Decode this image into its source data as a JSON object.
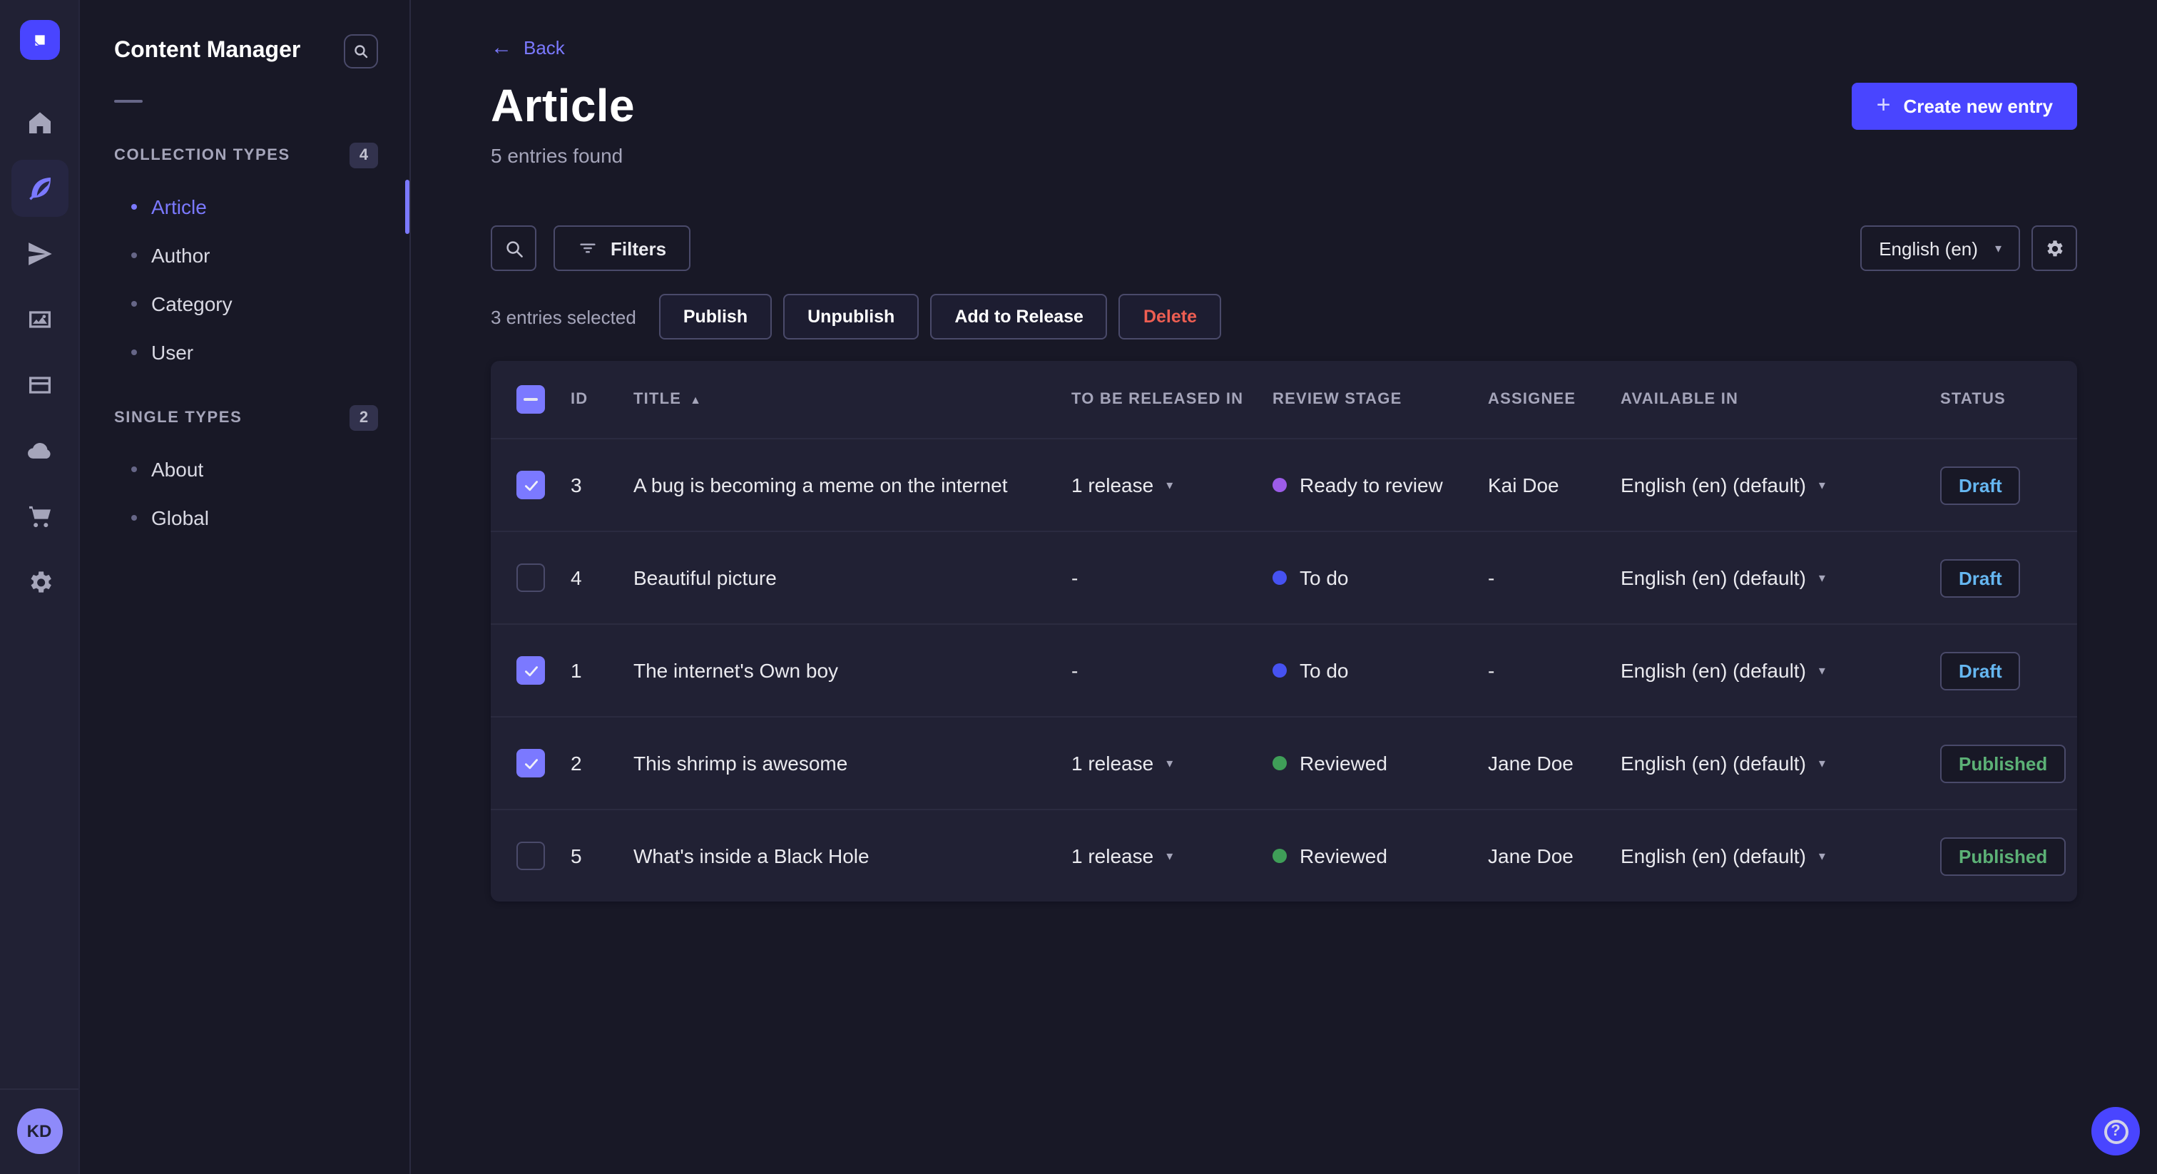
{
  "nav_rail": {
    "logo": "strapi-logo",
    "items": [
      {
        "icon": "home-icon",
        "active": false
      },
      {
        "icon": "content-manager-feather-icon",
        "active": true
      },
      {
        "icon": "releases-paper-plane-icon",
        "active": false
      },
      {
        "icon": "media-library-images-icon",
        "active": false
      },
      {
        "icon": "content-type-builder-layout-icon",
        "active": false
      },
      {
        "icon": "deploy-cloud-icon",
        "active": false
      },
      {
        "icon": "marketplace-cart-icon",
        "active": false
      },
      {
        "icon": "settings-gear-icon",
        "active": false
      }
    ],
    "avatar_initials": "KD"
  },
  "subnav": {
    "title": "Content Manager",
    "search_icon": "search-icon",
    "sections": [
      {
        "label": "COLLECTION TYPES",
        "count": "4",
        "items": [
          {
            "label": "Article",
            "active": true
          },
          {
            "label": "Author",
            "active": false
          },
          {
            "label": "Category",
            "active": false
          },
          {
            "label": "User",
            "active": false
          }
        ]
      },
      {
        "label": "SINGLE TYPES",
        "count": "2",
        "items": [
          {
            "label": "About",
            "active": false
          },
          {
            "label": "Global",
            "active": false
          }
        ]
      }
    ]
  },
  "header": {
    "back_label": "Back",
    "back_arrow": "←",
    "title": "Article",
    "subtitle": "5 entries found",
    "create_button_label": "Create new entry",
    "create_button_plus": "+"
  },
  "toolbar": {
    "search_icon": "search-icon",
    "filters_label": "Filters",
    "locale_value": "English (en)",
    "caret": "▾",
    "settings_icon": "gear-icon"
  },
  "selection": {
    "text": "3 entries selected",
    "actions": [
      {
        "label": "Publish",
        "danger": false
      },
      {
        "label": "Unpublish",
        "danger": false
      },
      {
        "label": "Add to Release",
        "danger": false
      },
      {
        "label": "Delete",
        "danger": true
      }
    ]
  },
  "table": {
    "header_checkbox_state": "indeterminate",
    "columns": [
      {
        "label": "ID",
        "sort": null
      },
      {
        "label": "TITLE",
        "sort": "asc",
        "sort_arrow": "▲"
      },
      {
        "label": "TO BE RELEASED IN",
        "sort": null
      },
      {
        "label": "REVIEW STAGE",
        "sort": null
      },
      {
        "label": "ASSIGNEE",
        "sort": null
      },
      {
        "label": "AVAILABLE IN",
        "sort": null
      },
      {
        "label": "STATUS",
        "sort": null
      }
    ],
    "rows": [
      {
        "checked": true,
        "id": "3",
        "title": "A bug is becoming a meme on the internet",
        "release": "1 release",
        "release_caret": true,
        "stage": "Ready to review",
        "stage_color": "#9c5ce8",
        "assignee": "Kai Doe",
        "locale": "English (en) (default)",
        "status": "Draft"
      },
      {
        "checked": false,
        "id": "4",
        "title": "Beautiful picture",
        "release": "-",
        "release_caret": false,
        "stage": "To do",
        "stage_color": "#4652f1",
        "assignee": "-",
        "locale": "English (en) (default)",
        "status": "Draft"
      },
      {
        "checked": true,
        "id": "1",
        "title": "The internet's Own boy",
        "release": "-",
        "release_caret": false,
        "stage": "To do",
        "stage_color": "#4652f1",
        "assignee": "-",
        "locale": "English (en) (default)",
        "status": "Draft"
      },
      {
        "checked": true,
        "id": "2",
        "title": "This shrimp is awesome",
        "release": "1 release",
        "release_caret": true,
        "stage": "Reviewed",
        "stage_color": "#3f9e58",
        "assignee": "Jane Doe",
        "locale": "English (en) (default)",
        "status": "Published"
      },
      {
        "checked": false,
        "id": "5",
        "title": "What's inside a Black Hole",
        "release": "1 release",
        "release_caret": true,
        "stage": "Reviewed",
        "stage_color": "#3f9e58",
        "assignee": "Jane Doe",
        "locale": "English (en) (default)",
        "status": "Published"
      }
    ]
  },
  "help": {
    "icon": "help-question-icon",
    "glyph": "?"
  },
  "colors": {
    "primary": "#4945ff",
    "link_active": "#7b79ff",
    "draft_text": "#66b7f1",
    "published_text": "#5cb176",
    "delete_text": "#ee5e52",
    "stage_todo": "#4652f1",
    "stage_ready_to_review": "#9c5ce8",
    "stage_reviewed": "#3f9e58",
    "page_bg": "#181826",
    "card_bg": "#212134"
  }
}
